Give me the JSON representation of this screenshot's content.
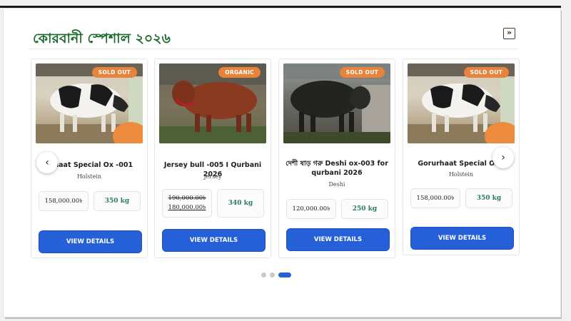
{
  "section": {
    "title": "কোরবানী স্পেশাল ২০২৬",
    "next_icon": "double-chevron-right-icon"
  },
  "cards": [
    {
      "badge": "SOLD OUT",
      "name": "Gorurhaat Special Ox -001",
      "visible_name": "urhaat Special Ox -001",
      "breed": "Holstein",
      "old_price": "",
      "price": "158,000.00৳",
      "weight": "350 kg",
      "button": "VIEW DETAILS"
    },
    {
      "badge": "ORGANIC",
      "name": "Jersey bull -005 I Qurbani 2026",
      "breed": "Jersey",
      "old_price": "190,000.00৳",
      "price": "180,000.00৳",
      "weight": "340 kg",
      "button": "VIEW DETAILS"
    },
    {
      "badge": "SOLD OUT",
      "name": "দেশী ষাড় গরু Deshi ox-003 for qurbani 2026",
      "breed": "Deshi",
      "old_price": "",
      "price": "120,000.00৳",
      "weight": "250 kg",
      "button": "VIEW DETAILS"
    },
    {
      "badge": "SOLD OUT",
      "name": "Gorurhaat Special Ox -",
      "breed": "Holstein",
      "old_price": "",
      "price": "158,000.00৳",
      "weight": "350 kg",
      "button": "VIEW DETAILS"
    }
  ],
  "carousel": {
    "prev_label": "‹",
    "next_label": "›",
    "page_count": 3,
    "active_page": 3
  },
  "colors": {
    "title_green": "#1d6b2b",
    "button_blue": "#2660d8",
    "badge_orange": "#e7833a",
    "weight_green": "#2f7d5a"
  }
}
